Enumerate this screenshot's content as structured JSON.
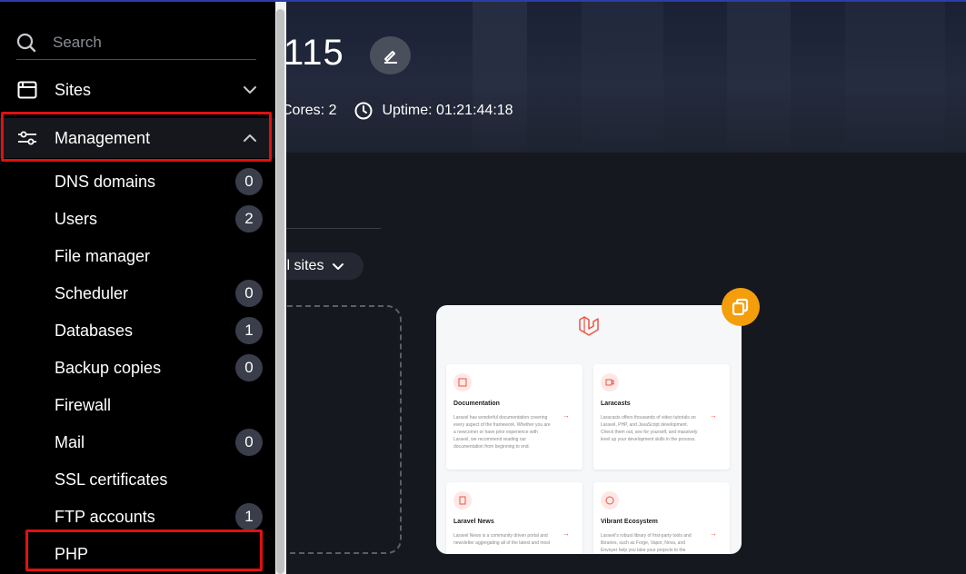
{
  "header": {
    "server_title_partial": "115",
    "cores_text": "Cores: 2",
    "uptime_text": "Uptime: 01:21:44:18"
  },
  "content": {
    "filter_label": "ll sites"
  },
  "site_thumbnail": {
    "tiles": [
      {
        "title": "Documentation",
        "text": "Laravel has wonderful documentation covering every aspect of the framework. Whether you are a newcomer or have prior experience with Laravel, we recommend reading our documentation from beginning to end."
      },
      {
        "title": "Laracasts",
        "text": "Laracasts offers thousands of video tutorials on Laravel, PHP, and JavaScript development. Check them out, see for yourself, and massively level up your development skills in the process."
      },
      {
        "title": "Laravel News",
        "text": "Laravel News is a community driven portal and newsletter aggregating all of the latest and most"
      },
      {
        "title": "Vibrant Ecosystem",
        "text": "Laravel's robust library of first-party tools and libraries, such as Forge, Vapor, Nova, and Envoyer help you take your projects to the"
      }
    ]
  },
  "sidebar": {
    "search_placeholder": "Search",
    "sites_label": "Sites",
    "management_label": "Management",
    "items": [
      {
        "label": "DNS domains",
        "badge": "0"
      },
      {
        "label": "Users",
        "badge": "2"
      },
      {
        "label": "File manager",
        "badge": null
      },
      {
        "label": "Scheduler",
        "badge": "0"
      },
      {
        "label": "Databases",
        "badge": "1"
      },
      {
        "label": "Backup copies",
        "badge": "0"
      },
      {
        "label": "Firewall",
        "badge": null
      },
      {
        "label": "Mail",
        "badge": "0"
      },
      {
        "label": "SSL certificates",
        "badge": null
      },
      {
        "label": "FTP accounts",
        "badge": "1"
      },
      {
        "label": "PHP",
        "badge": null
      }
    ]
  },
  "colors": {
    "highlight": "#e01010",
    "copy_button": "#f59e0b",
    "laravel_red": "#f05340"
  }
}
